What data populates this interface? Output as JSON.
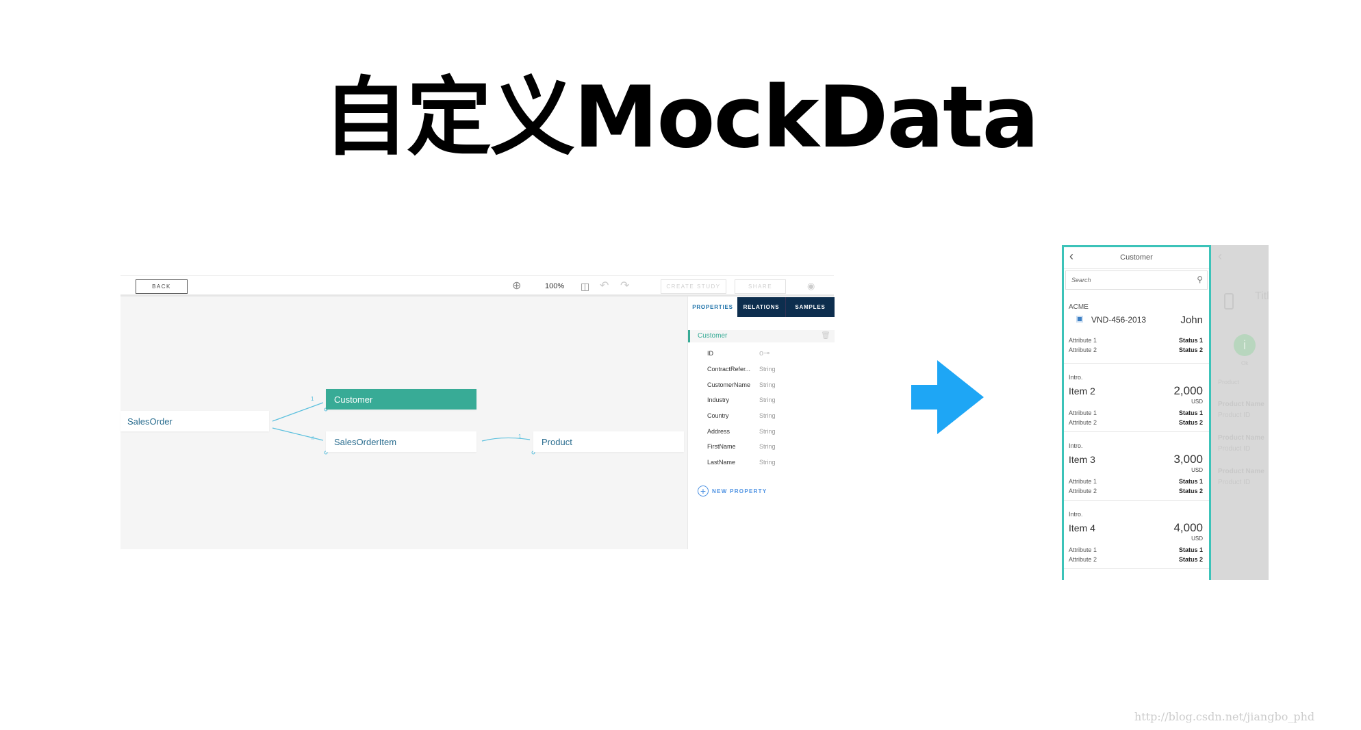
{
  "title": "自定义MockData",
  "editor": {
    "toolbar": {
      "back": "BACK",
      "zoom": "100%",
      "create_study": "CREATE STUDY",
      "share": "SHARE"
    },
    "nodes": {
      "sales_order": "SalesOrder",
      "customer": "Customer",
      "sales_order_item": "SalesOrderItem",
      "product": "Product"
    },
    "edges": {
      "so_customer": "1",
      "so_item": "n",
      "item_product": "1"
    },
    "panel": {
      "tabs": [
        "PROPERTIES",
        "RELATIONS",
        "SAMPLES"
      ],
      "entity": "Customer",
      "properties": [
        {
          "name": "ID",
          "type": ""
        },
        {
          "name": "ContractRefer...",
          "type": "String"
        },
        {
          "name": "CustomerName",
          "type": "String"
        },
        {
          "name": "Industry",
          "type": "String"
        },
        {
          "name": "Country",
          "type": "String"
        },
        {
          "name": "Address",
          "type": "String"
        },
        {
          "name": "FirstName",
          "type": "String"
        },
        {
          "name": "LastName",
          "type": "String"
        }
      ],
      "new_property": "NEW PROPERTY"
    }
  },
  "arrow_color": "#1ea6f5",
  "phone": {
    "header": "Customer",
    "search_placeholder": "Search",
    "first": {
      "group": "ACME",
      "id": "VND-456-2013",
      "name": "John",
      "attr1": "Attribute 1",
      "attr2": "Attribute 2",
      "status1": "Status 1",
      "status2": "Status 2"
    },
    "items": [
      {
        "intro": "Intro.",
        "title": "Item 2",
        "amount": "2,000",
        "currency": "USD",
        "attr1": "Attribute 1",
        "attr2": "Attribute 2",
        "status1": "Status 1",
        "status2": "Status 2"
      },
      {
        "intro": "Intro.",
        "title": "Item 3",
        "amount": "3,000",
        "currency": "USD",
        "attr1": "Attribute 1",
        "attr2": "Attribute 2",
        "status1": "Status 1",
        "status2": "Status 2"
      },
      {
        "intro": "Intro.",
        "title": "Item 4",
        "amount": "4,000",
        "currency": "USD",
        "attr1": "Attribute 1",
        "attr2": "Attribute 2",
        "status1": "Status 1",
        "status2": "Status 2"
      }
    ],
    "overlay": {
      "title": "Titl",
      "ok": "Ok",
      "product": "Product",
      "rows": [
        {
          "name": "Product Name",
          "id": "Product ID"
        },
        {
          "name": "Product Name",
          "id": "Product ID"
        },
        {
          "name": "Product Name",
          "id": "Product ID"
        }
      ]
    }
  },
  "watermark": "http://blog.csdn.net/jiangbo_phd"
}
